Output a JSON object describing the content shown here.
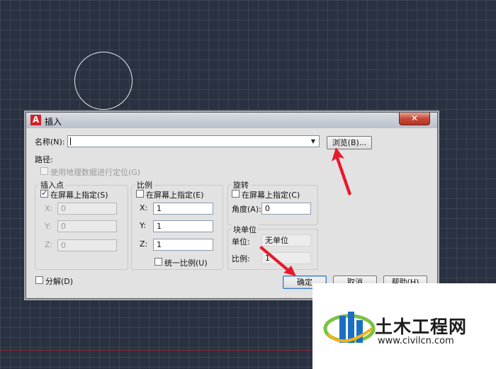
{
  "dialog": {
    "title": "插入",
    "close_icon": "✕",
    "name_label": "名称(N):",
    "name_value": "",
    "browse_button": "浏览(B)...",
    "path_label": "路径:",
    "geo_checkbox": {
      "label": "使用地理数据进行定位(G)",
      "checked": false,
      "enabled": false
    },
    "insertion_point": {
      "title": "插入点",
      "on_screen_label": "在屏幕上指定(S)",
      "on_screen_checked": true,
      "x_label": "X:",
      "x_value": "0",
      "y_label": "Y:",
      "y_value": "0",
      "z_label": "Z:",
      "z_value": "0"
    },
    "scale": {
      "title": "比例",
      "on_screen_label": "在屏幕上指定(E)",
      "on_screen_checked": false,
      "x_label": "X:",
      "x_value": "1",
      "y_label": "Y:",
      "y_value": "1",
      "z_label": "Z:",
      "z_value": "1",
      "uniform_label": "统一比例(U)",
      "uniform_checked": false
    },
    "rotation": {
      "title": "旋转",
      "on_screen_label": "在屏幕上指定(C)",
      "on_screen_checked": false,
      "angle_label": "角度(A):",
      "angle_value": "0"
    },
    "block_unit": {
      "title": "块单位",
      "unit_label": "单位:",
      "unit_value": "无单位",
      "factor_label": "比例:",
      "factor_value": "1"
    },
    "explode_label": "分解(D)",
    "explode_checked": false,
    "ok_button": "确定",
    "cancel_button": "取消",
    "help_button": "帮助(H)"
  },
  "watermark": {
    "title": "土木工程网",
    "url": "www.civilcn.com"
  },
  "colors": {
    "canvas": "#2a3140",
    "arrow": "#e8192c",
    "dialog_bg": "#e2e2e2"
  }
}
